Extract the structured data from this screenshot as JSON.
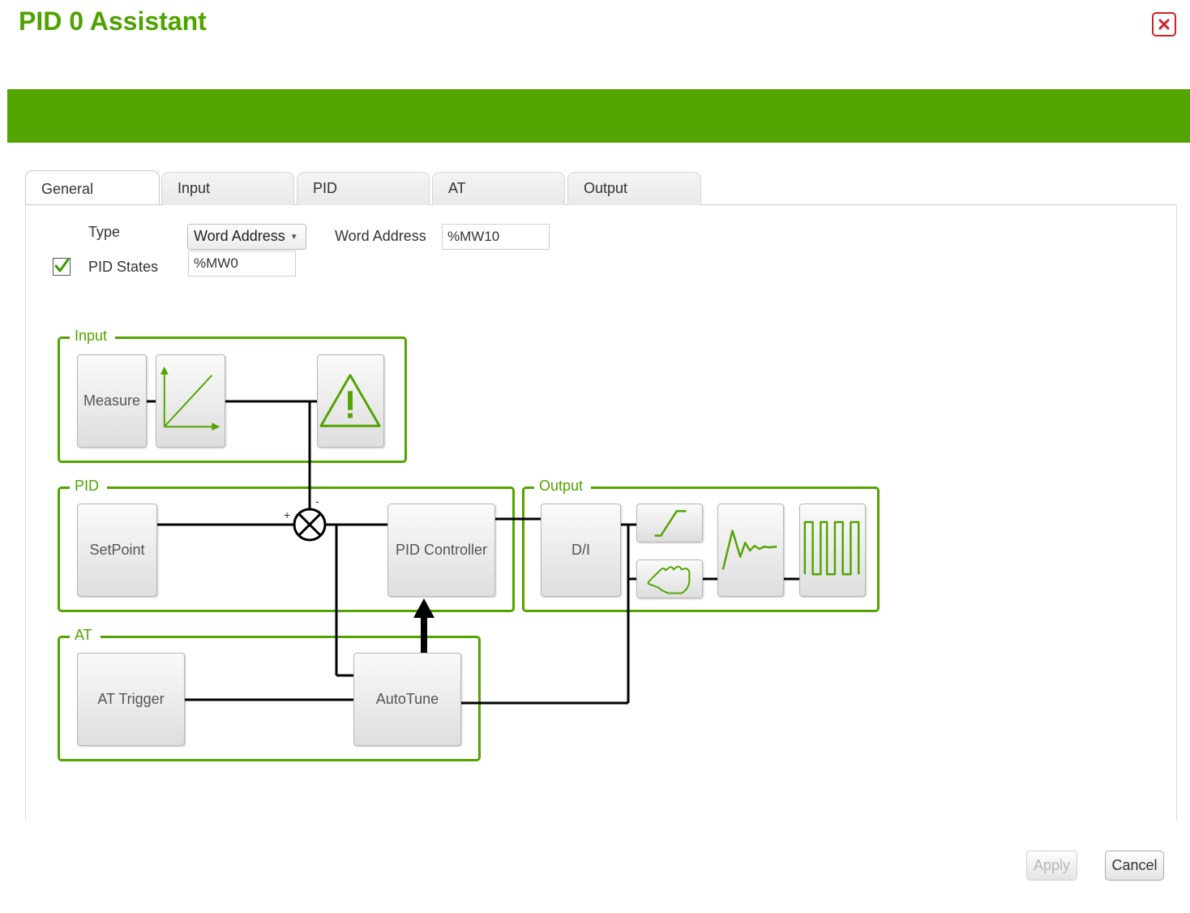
{
  "window": {
    "title": "PID 0 Assistant"
  },
  "tabs": [
    {
      "label": "General",
      "active": true
    },
    {
      "label": "Input",
      "active": false
    },
    {
      "label": "PID",
      "active": false
    },
    {
      "label": "AT",
      "active": false
    },
    {
      "label": "Output",
      "active": false
    }
  ],
  "general": {
    "type_label": "Type",
    "type_value": "Word Address",
    "word_address_label": "Word Address",
    "word_address_value": "%MW10",
    "pid_states_label": "PID States",
    "pid_states_checked": true,
    "pid_states_value": "%MW0"
  },
  "diagram": {
    "groups": {
      "input": "Input",
      "pid": "PID",
      "output": "Output",
      "at": "AT"
    },
    "blocks": {
      "measure": "Measure",
      "setpoint": "SetPoint",
      "pid_controller": "PID Controller",
      "di": "D/I",
      "at_trigger": "AT Trigger",
      "autotune": "AutoTune"
    },
    "summing_signs": {
      "plus": "+",
      "minus": "-"
    }
  },
  "footer": {
    "apply": "Apply",
    "apply_enabled": false,
    "cancel": "Cancel"
  },
  "colors": {
    "brand_green": "#52a400",
    "title_green": "#4ea300",
    "close_red": "#d0202a"
  }
}
